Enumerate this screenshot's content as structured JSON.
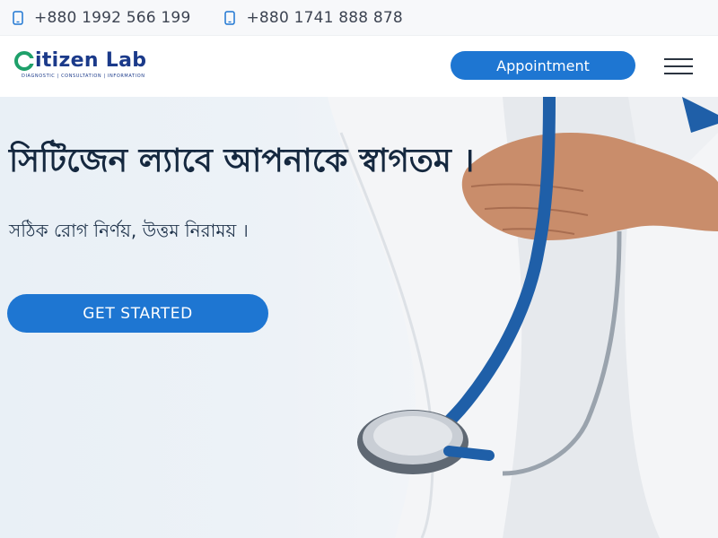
{
  "topbar": {
    "phones": [
      {
        "number": "+880 1992 566 199",
        "icon": "mobile-phone-icon"
      },
      {
        "number": "+880 1741 888 878",
        "icon": "mobile-phone-icon"
      }
    ]
  },
  "nav": {
    "logo": {
      "word": "itizen Lab",
      "tagline": "DIAGNOSTIC | CONSULTATION | INFORMATION"
    },
    "appointment_label": "Appointment",
    "menu_icon": "hamburger-menu-icon"
  },
  "hero": {
    "title": "সিটিজেন ল্যাবে আপনাকে স্বাগতম ।",
    "subtitle": "সঠিক রোগ নির্ণয়, উত্তম নিরাময় ।",
    "cta_label": "GET STARTED"
  },
  "colors": {
    "accent": "#1e76d2",
    "logo_blue": "#1b3a8a",
    "logo_green": "#1ea06a",
    "stethoscope": "#1f5fa8"
  }
}
